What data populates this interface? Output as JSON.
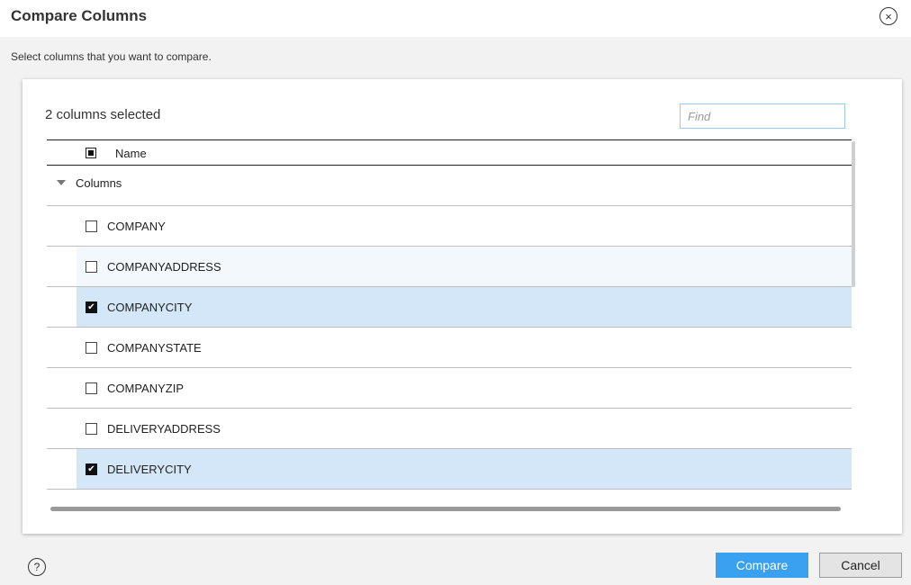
{
  "dialog": {
    "title": "Compare Columns",
    "close_icon": "×",
    "subtitle": "Select columns that you want to compare."
  },
  "panel": {
    "selected_count_text": "2 columns selected",
    "find_placeholder": "Find",
    "find_value": ""
  },
  "grid": {
    "header": {
      "name_label": "Name",
      "select_all_state": "partial"
    },
    "group": {
      "label": "Columns",
      "expanded": true
    },
    "rows": [
      {
        "label": "COMPANY",
        "checked": false,
        "state": "normal"
      },
      {
        "label": "COMPANYADDRESS",
        "checked": false,
        "state": "hover"
      },
      {
        "label": "COMPANYCITY",
        "checked": true,
        "state": "selected"
      },
      {
        "label": "COMPANYSTATE",
        "checked": false,
        "state": "normal"
      },
      {
        "label": "COMPANYZIP",
        "checked": false,
        "state": "normal"
      },
      {
        "label": "DELIVERYADDRESS",
        "checked": false,
        "state": "normal"
      },
      {
        "label": "DELIVERYCITY",
        "checked": true,
        "state": "selected"
      }
    ]
  },
  "footer": {
    "help_icon": "?",
    "compare_label": "Compare",
    "cancel_label": "Cancel"
  },
  "colors": {
    "primary_button": "#3aa0f0",
    "selected_row": "#d4e7f8",
    "hover_row": "#f3f8fd"
  }
}
